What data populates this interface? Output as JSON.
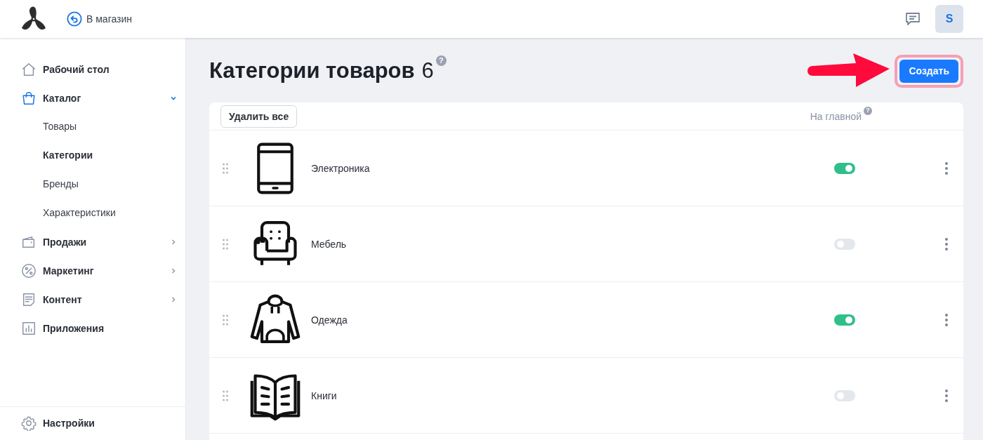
{
  "header": {
    "back_link": "В магазин",
    "avatar": "S"
  },
  "sidebar": {
    "items": [
      {
        "label": "Рабочий стол",
        "kind": "link",
        "selected": false
      },
      {
        "label": "Каталог",
        "kind": "group",
        "selected": true,
        "expanded": true,
        "children": [
          {
            "label": "Товары",
            "selected": false
          },
          {
            "label": "Категории",
            "selected": true
          },
          {
            "label": "Бренды",
            "selected": false
          },
          {
            "label": "Характеристики",
            "selected": false
          }
        ]
      },
      {
        "label": "Продажи",
        "kind": "group",
        "selected": false,
        "expanded": false
      },
      {
        "label": "Маркетинг",
        "kind": "group",
        "selected": false,
        "expanded": false
      },
      {
        "label": "Контент",
        "kind": "group",
        "selected": false,
        "expanded": false
      },
      {
        "label": "Приложения",
        "kind": "link",
        "selected": false
      }
    ],
    "footer_item": "Настройки"
  },
  "page": {
    "title": "Категории товаров",
    "count": "6",
    "help_mark": "?",
    "create_button": "Создать",
    "create_highlighted": true
  },
  "table": {
    "delete_all_button": "Удалить все",
    "column_on_main": "На главной",
    "column_help_mark": "?",
    "rows": [
      {
        "name": "Электроника",
        "on_main": true
      },
      {
        "name": "Мебель",
        "on_main": false
      },
      {
        "name": "Одежда",
        "on_main": true
      },
      {
        "name": "Книги",
        "on_main": false
      }
    ]
  }
}
